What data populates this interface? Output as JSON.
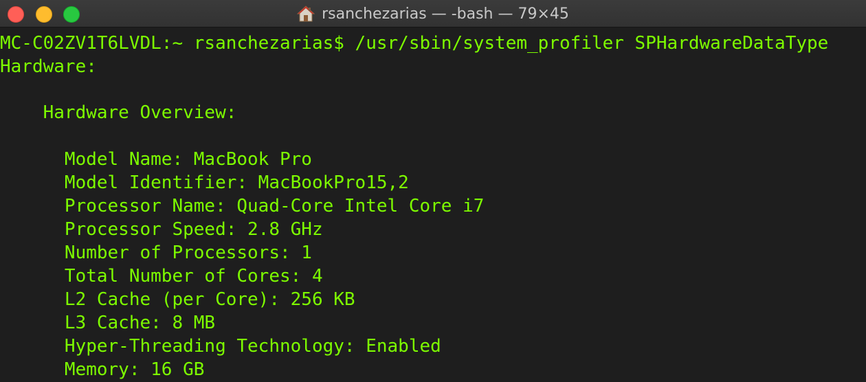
{
  "window": {
    "title": "rsanchezarias — -bash — 79×45"
  },
  "terminal": {
    "lines": [
      "MC-C02ZV1T6LVDL:~ rsanchezarias$ /usr/sbin/system_profiler SPHardwareDataType",
      "Hardware:",
      "",
      "    Hardware Overview:",
      "",
      "      Model Name: MacBook Pro",
      "      Model Identifier: MacBookPro15,2",
      "      Processor Name: Quad-Core Intel Core i7",
      "      Processor Speed: 2.8 GHz",
      "      Number of Processors: 1",
      "      Total Number of Cores: 4",
      "      L2 Cache (per Core): 256 KB",
      "      L3 Cache: 8 MB",
      "      Hyper-Threading Technology: Enabled",
      "      Memory: 16 GB"
    ]
  },
  "colors": {
    "background": "#1e1e1e",
    "text": "#7dfc00",
    "titlebar": "#363636",
    "close": "#ff5f57",
    "minimize": "#febc2e",
    "zoom": "#28c840"
  },
  "icons": {
    "title_icon": "home-icon"
  }
}
